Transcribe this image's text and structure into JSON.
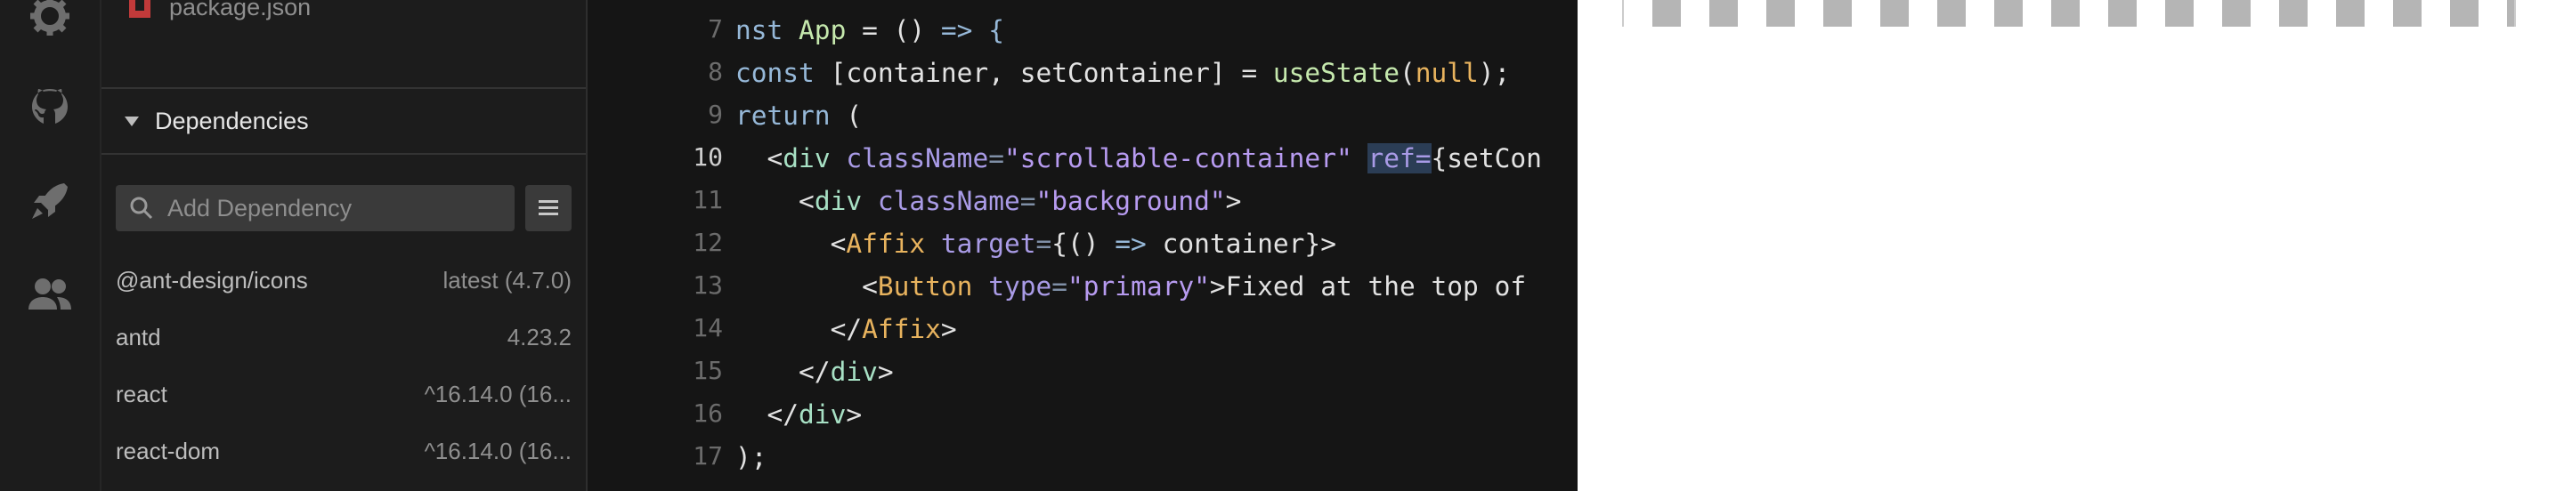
{
  "activity_bar": {
    "icons": [
      "gear-icon",
      "github-icon",
      "rocket-icon",
      "team-icon"
    ]
  },
  "sidebar": {
    "file": {
      "name": "package.json",
      "icon": "package-file-icon"
    },
    "dependencies_title": "Dependencies",
    "search": {
      "placeholder": "Add Dependency",
      "value": ""
    },
    "dependencies": [
      {
        "name": "@ant-design/icons",
        "version": "latest (4.7.0)"
      },
      {
        "name": "antd",
        "version": "4.23.2"
      },
      {
        "name": "react",
        "version": "^16.14.0 (16..."
      },
      {
        "name": "react-dom",
        "version": "^16.14.0 (16..."
      }
    ]
  },
  "editor": {
    "current_line": "10",
    "line_numbers": [
      "7",
      "8",
      "9",
      "10",
      "11",
      "12",
      "13",
      "14",
      "15",
      "16",
      "17"
    ],
    "lines": {
      "l7": {
        "a": "nst ",
        "b": "App",
        "c": " = () ",
        "d": "=>",
        "e": " {"
      },
      "l8": {
        "a": "const",
        "b": " [container, setContainer] = ",
        "c": "useState",
        "d": "(",
        "e": "null",
        "f": ");"
      },
      "l9": {
        "a": "return",
        "b": " ("
      },
      "l10": {
        "a": "  <",
        "b": "div",
        "c": " ",
        "d": "className",
        "e": "=",
        "f": "\"scrollable-container\"",
        "g": " ",
        "h": "ref=",
        "i": "{setCon"
      },
      "l11": {
        "a": "    <",
        "b": "div",
        "c": " ",
        "d": "className",
        "e": "=",
        "f": "\"background\"",
        "g": ">"
      },
      "l12": {
        "a": "      <",
        "b": "Affix",
        "c": " ",
        "d": "target",
        "e": "=",
        "f": "{() ",
        "g": "=>",
        "h": " container}>"
      },
      "l13": {
        "a": "        <",
        "b": "Button",
        "c": " ",
        "d": "type",
        "e": "=",
        "f": "\"primary\"",
        "g": ">Fixed at the top of"
      },
      "l14": {
        "a": "      </",
        "b": "Affix",
        "c": ">"
      },
      "l15": {
        "a": "    </",
        "b": "div",
        "c": ">"
      },
      "l16": {
        "a": "  </",
        "b": "div",
        "c": ">"
      },
      "l17": {
        "a": ");"
      }
    }
  },
  "colors": {
    "background": "#151515",
    "sidebar": "#1c1c1c",
    "keyword": "#96b8d8",
    "tag": "#a7e0c4",
    "attribute": "#a99be6",
    "string": "#b79bf0",
    "component": "#e8b35e",
    "preview": "#ffffff"
  }
}
